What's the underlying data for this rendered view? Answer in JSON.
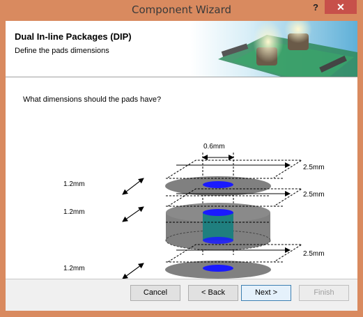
{
  "window": {
    "title": "Component Wizard",
    "help_glyph": "?",
    "close_glyph": "✕"
  },
  "header": {
    "title": "Dual In-line Packages (DIP)",
    "subtitle": "Define the pads dimensions"
  },
  "body": {
    "question": "What dimensions should the pads have?",
    "dimensions": {
      "hole_size": "0.6mm",
      "top_pad_height": "1.2mm",
      "middle_pad_height": "1.2mm",
      "bottom_pad_height": "1.2mm",
      "top_pad_width": "2.5mm",
      "middle_pad_width": "2.5mm",
      "bottom_pad_width": "2.5mm"
    }
  },
  "buttons": {
    "cancel": "Cancel",
    "back": "< Back",
    "next": "Next >",
    "finish": "Finish"
  },
  "colors": {
    "accent_close": "#c7504a",
    "frame": "#d98a5f",
    "pad_gray": "#808080",
    "hole_blue": "#1a1aff",
    "barrel_teal": "#1f7f7f"
  }
}
